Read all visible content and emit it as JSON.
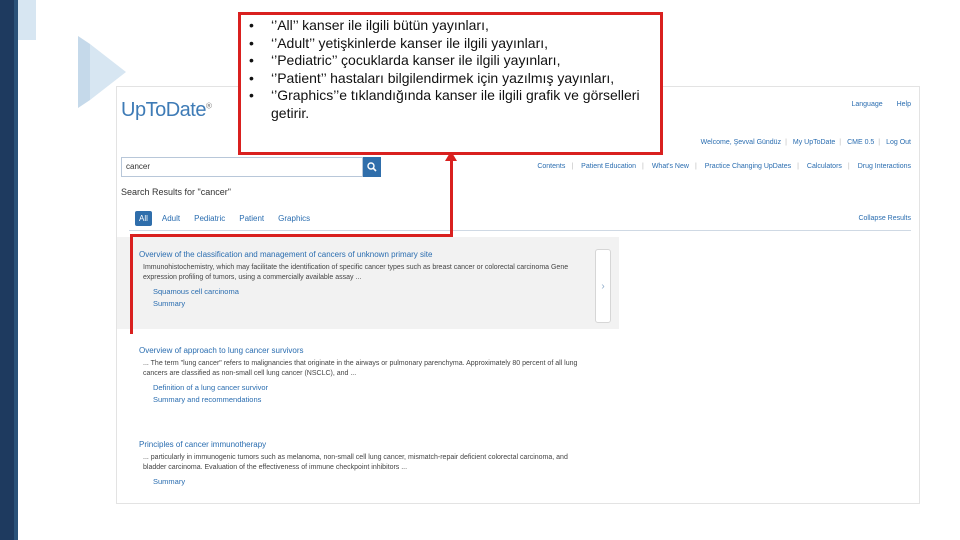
{
  "callout": {
    "items": [
      "‘’All’’ kanser ile ilgili bütün yayınları,",
      "‘’Adult’’ yetişkinlerde kanser ile ilgili yayınları,",
      "‘’Pediatric’’ çocuklarda kanser ile ilgili yayınları,",
      "‘’Patient’’ hastaları bilgilendirmek için yazılmış yayınları,",
      "‘’Graphics’’e tıklandığında kanser ile ilgili grafik ve görselleri getirir."
    ]
  },
  "app": {
    "logo": "UpToDate",
    "logo_mark": "®",
    "top_links": [
      "Language",
      "Help"
    ],
    "welcome": [
      "Welcome, Şevval Gündüz",
      "My UpToDate",
      "CME 0.5",
      "Log Out"
    ],
    "search_value": "cancer",
    "nav_links": [
      "Contents",
      "Patient Education",
      "What's New",
      "Practice Changing UpDates",
      "Calculators",
      "Drug Interactions"
    ],
    "results_title": "Search Results for \"cancer\"",
    "tabs": [
      "All",
      "Adult",
      "Pediatric",
      "Patient",
      "Graphics"
    ],
    "active_tab": "All",
    "collapse": "Collapse Results",
    "side_arrow": "›"
  },
  "results": [
    {
      "title": "Overview of the classification and management of cancers of unknown primary site",
      "desc": "Immunohistochemistry, which may facilitate the identification of specific cancer types such as breast cancer or colorectal carcinoma Gene expression profiling of tumors, using a commercially available assay ...",
      "subs": [
        "Squamous cell carcinoma",
        "Summary"
      ]
    },
    {
      "title": "Overview of approach to lung cancer survivors",
      "desc": "... The term \"lung cancer\" refers to malignancies that originate in the airways or pulmonary parenchyma. Approximately 80 percent of all lung cancers are classified as non-small cell lung cancer (NSCLC), and ...",
      "subs": [
        "Definition of a lung cancer survivor",
        "Summary and recommendations"
      ]
    },
    {
      "title": "Principles of cancer immunotherapy",
      "desc": "... particularly in immunogenic tumors such as melanoma, non-small cell lung cancer, mismatch-repair deficient colorectal carcinoma, and bladder carcinoma. Evaluation of the effectiveness of immune checkpoint inhibitors ...",
      "subs": [
        "Summary"
      ]
    }
  ]
}
